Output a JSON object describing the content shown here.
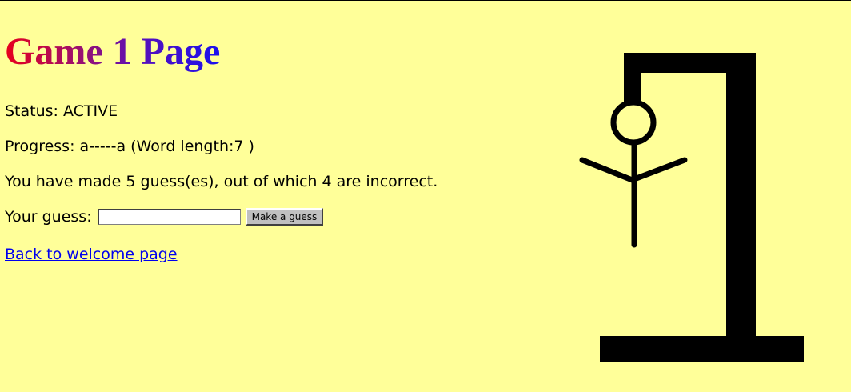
{
  "page": {
    "title": "Game 1 Page",
    "background_color": "#ffff99"
  },
  "game": {
    "status_text": "Status: ACTIVE",
    "progress_text": "Progress: a-----a (Word length:7 )",
    "guesses_text": "You have made 5 guess(es), out of which 4 are incorrect.",
    "guess_label": "Your guess:",
    "guess_input_value": "",
    "guess_button_label": "Make a guess",
    "back_link_label": "Back to welcome page"
  },
  "illustration": {
    "icon": "hangman-gallows-icon",
    "incorrect_guesses_shown": 4
  }
}
